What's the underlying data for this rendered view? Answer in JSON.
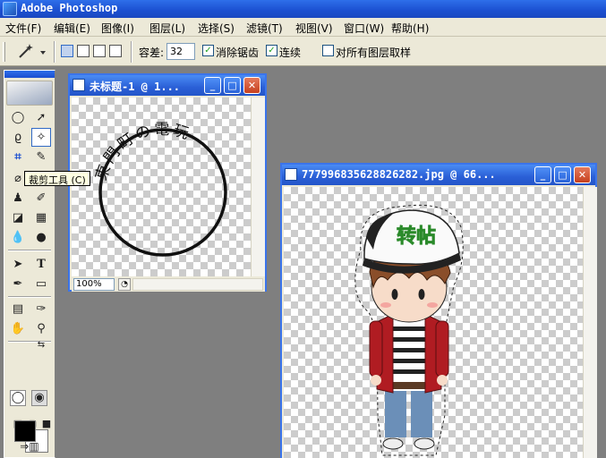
{
  "app": {
    "title": "Adobe Photoshop"
  },
  "menu": [
    "文件(F)",
    "编辑(E)",
    "图像(I)",
    "图层(L)",
    "选择(S)",
    "滤镜(T)",
    "视图(V)",
    "窗口(W)",
    "帮助(H)"
  ],
  "options": {
    "tolerance_label": "容差:",
    "tolerance_value": "32",
    "antialias_label": "消除锯齿",
    "antialias_checked": true,
    "contiguous_label": "连续",
    "contiguous_checked": true,
    "all_layers_label": "对所有图层取样",
    "all_layers_checked": false
  },
  "tooltip": "裁剪工具 (C)",
  "doc1": {
    "title": "未标题-1 @ 1...",
    "zoom": "100%",
    "circle_text": "東門町の電玩"
  },
  "doc2": {
    "title": "777996835628826282.jpg @ 66...",
    "cap_text": "转帖"
  },
  "colors": {
    "accent": "#2456c9",
    "close": "#c6401f",
    "jacket": "#b01c22",
    "jeans": "#6b8fb8",
    "hair": "#8a4e2a"
  }
}
